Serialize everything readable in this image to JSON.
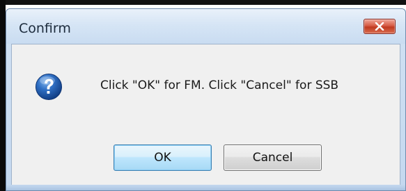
{
  "window": {
    "title": "Confirm",
    "close_icon": "close-icon"
  },
  "dialog": {
    "icon": "question-icon",
    "message": "Click \"OK\" for FM. Click \"Cancel\" for SSB"
  },
  "buttons": {
    "ok_label": "OK",
    "cancel_label": "Cancel"
  },
  "colors": {
    "titlebar": "#d6e5f5",
    "close_button": "#c7432a",
    "content_bg": "#f0f0f0",
    "ok_button_focus": "#bee6fd",
    "icon_blue": "#1f5aa6"
  }
}
